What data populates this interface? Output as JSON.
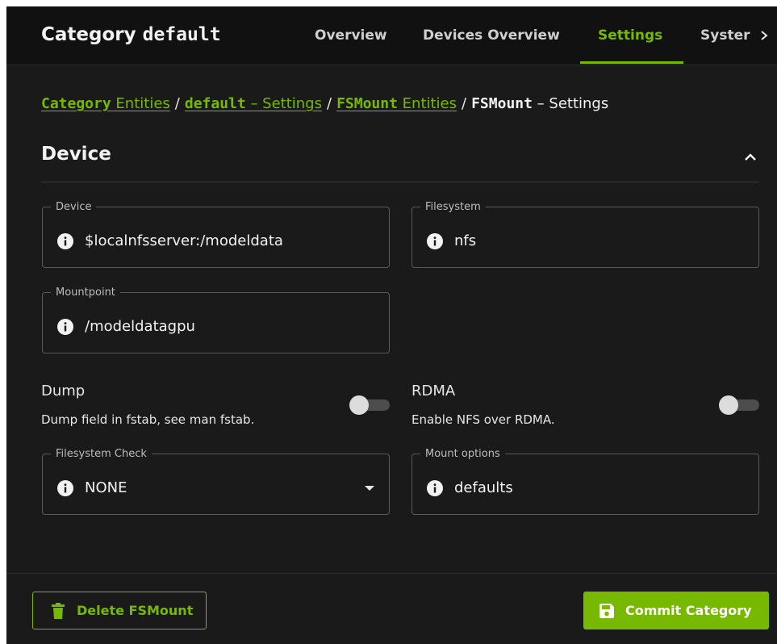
{
  "header": {
    "title_prefix": "Category ",
    "title_name": "default",
    "tabs": [
      {
        "label": "Overview"
      },
      {
        "label": "Devices Overview"
      },
      {
        "label": "Settings",
        "active": true
      },
      {
        "label": "Syster"
      }
    ],
    "more_icon": "chevron-right-icon"
  },
  "breadcrumb": {
    "items": [
      {
        "mono": "Category",
        "text": " Entities"
      },
      {
        "mono": "default",
        "text": " – Settings"
      },
      {
        "mono": "FSMount",
        "text": " Entities"
      },
      {
        "mono": "FSMount",
        "text": " – Settings"
      }
    ],
    "separator": "/"
  },
  "section": {
    "title": "Device",
    "collapse_icon": "chevron-up-icon"
  },
  "fields": {
    "device": {
      "label": "Device",
      "value": "$localnfsserver:/modeldata"
    },
    "filesystem": {
      "label": "Filesystem",
      "value": "nfs"
    },
    "mountpoint": {
      "label": "Mountpoint",
      "value": "/modeldatagpu"
    },
    "fscheck": {
      "label": "Filesystem Check",
      "value": "NONE"
    },
    "mount_options": {
      "label": "Mount options",
      "value": "defaults"
    }
  },
  "toggles": {
    "dump": {
      "label": "Dump",
      "description": "Dump field in fstab, see man fstab.",
      "on": false
    },
    "rdma": {
      "label": "RDMA",
      "description": "Enable NFS over RDMA.",
      "on": false
    }
  },
  "footer": {
    "delete_label": "Delete FSMount",
    "commit_label": "Commit Category"
  },
  "colors": {
    "accent": "#76b900",
    "background": "#1a1a1a",
    "header_background": "#111111"
  }
}
